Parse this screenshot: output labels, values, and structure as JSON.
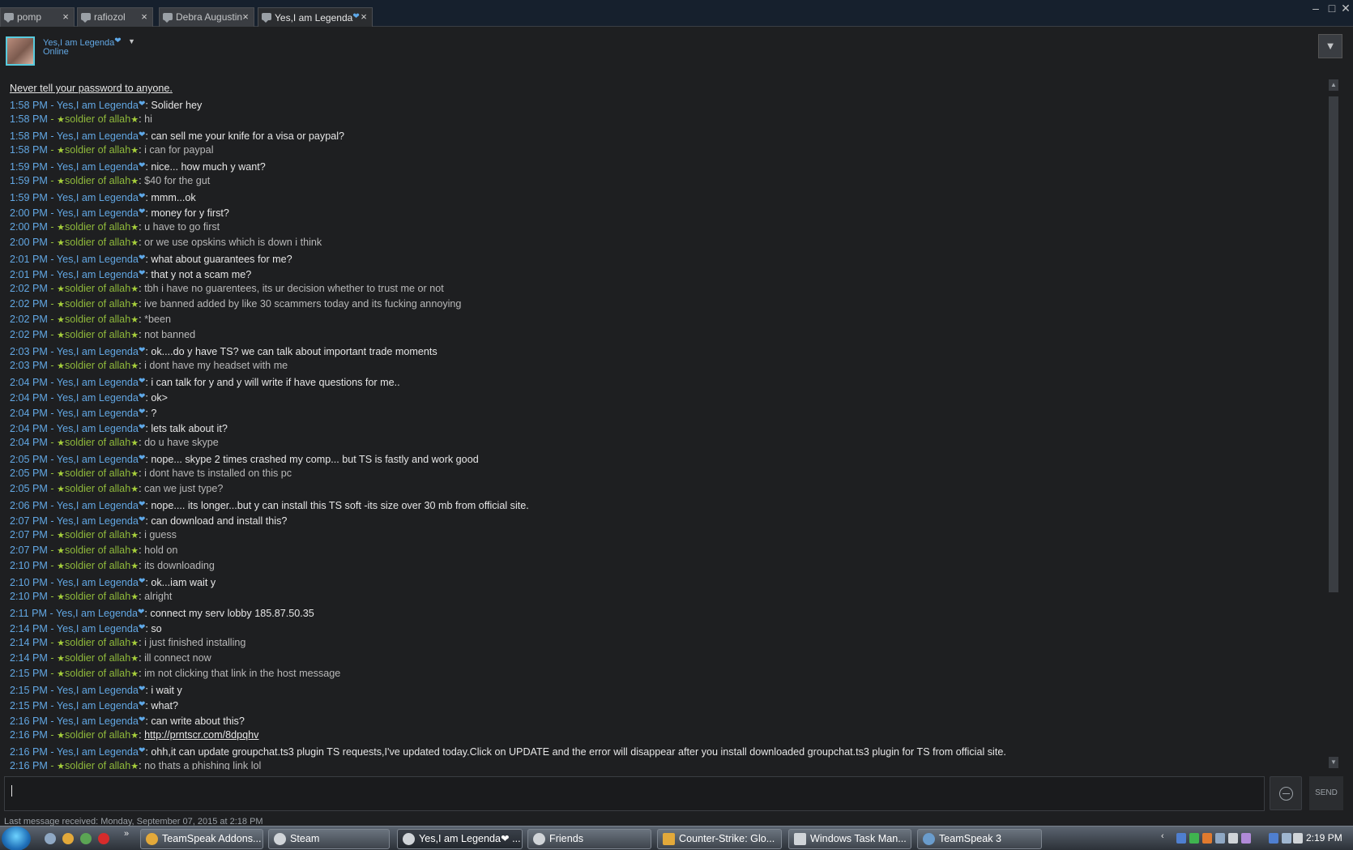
{
  "tabs": [
    {
      "label": "pomp",
      "close": "×",
      "active": false
    },
    {
      "label": "rafiozol",
      "close": "×",
      "active": false
    },
    {
      "label": "Debra Augustin",
      "close": "×",
      "active": false
    },
    {
      "label": "Yes,I am Legenda",
      "close": "×",
      "active": true
    }
  ],
  "window_controls": {
    "minimize": "–",
    "maximize": "□",
    "close": "✕"
  },
  "header": {
    "friend_name": "Yes,I am Legenda",
    "status": "Online",
    "dropdown": "▼"
  },
  "chat": {
    "warning": "Never tell your password to anyone.",
    "them_name": "Yes,I am Legenda",
    "me_name": "soldier of allah",
    "messages": [
      {
        "time": "1:58 PM",
        "from": "them",
        "text": "Solider hey"
      },
      {
        "time": "1:58 PM",
        "from": "me",
        "text": "hi"
      },
      {
        "time": "1:58 PM",
        "from": "them",
        "text": "can sell me your knife for a visa or paypal?"
      },
      {
        "time": "1:58 PM",
        "from": "me",
        "text": "i can for paypal"
      },
      {
        "time": "1:59 PM",
        "from": "them",
        "text": "nice... how much y want?"
      },
      {
        "time": "1:59 PM",
        "from": "me",
        "text": "$40 for the gut"
      },
      {
        "time": "1:59 PM",
        "from": "them",
        "text": "mmm...ok"
      },
      {
        "time": "2:00 PM",
        "from": "them",
        "text": "money for y first?"
      },
      {
        "time": "2:00 PM",
        "from": "me",
        "text": "u have to go first"
      },
      {
        "time": "2:00 PM",
        "from": "me",
        "text": "or we use opskins which is down i think"
      },
      {
        "time": "2:01 PM",
        "from": "them",
        "text": "what about guarantees for me?"
      },
      {
        "time": "2:01 PM",
        "from": "them",
        "text": "that y not a scam me?"
      },
      {
        "time": "2:02 PM",
        "from": "me",
        "text": "tbh i have no guarentees, its ur decision whether to trust me or not"
      },
      {
        "time": "2:02 PM",
        "from": "me",
        "text": "ive banned added by like 30 scammers today and its fucking annoying"
      },
      {
        "time": "2:02 PM",
        "from": "me",
        "text": "*been"
      },
      {
        "time": "2:02 PM",
        "from": "me",
        "text": "not banned"
      },
      {
        "time": "2:03 PM",
        "from": "them",
        "text": "ok....do y have TS? we can talk about important trade moments"
      },
      {
        "time": "2:03 PM",
        "from": "me",
        "text": "i dont have my headset with me"
      },
      {
        "time": "2:04 PM",
        "from": "them",
        "text": "i can talk for y and y will write if have questions for me.."
      },
      {
        "time": "2:04 PM",
        "from": "them",
        "text": "ok>"
      },
      {
        "time": "2:04 PM",
        "from": "them",
        "text": "?"
      },
      {
        "time": "2:04 PM",
        "from": "them",
        "text": "lets talk about it?"
      },
      {
        "time": "2:04 PM",
        "from": "me",
        "text": "do u have skype"
      },
      {
        "time": "2:05 PM",
        "from": "them",
        "text": "nope... skype 2 times crashed my comp... but TS is fastly and work good"
      },
      {
        "time": "2:05 PM",
        "from": "me",
        "text": "i dont have ts installed on this pc"
      },
      {
        "time": "2:05 PM",
        "from": "me",
        "text": "can we just type?"
      },
      {
        "time": "2:06 PM",
        "from": "them",
        "text": "nope.... its longer...but y can install this TS soft -its size over 30 mb from official site."
      },
      {
        "time": "2:07 PM",
        "from": "them",
        "text": "can download and install this?"
      },
      {
        "time": "2:07 PM",
        "from": "me",
        "text": "i guess"
      },
      {
        "time": "2:07 PM",
        "from": "me",
        "text": "hold on"
      },
      {
        "time": "2:10 PM",
        "from": "me",
        "text": "its downloading"
      },
      {
        "time": "2:10 PM",
        "from": "them",
        "text": "ok...iam wait y"
      },
      {
        "time": "2:10 PM",
        "from": "me",
        "text": "alright"
      },
      {
        "time": "2:11 PM",
        "from": "them",
        "text": "connect my serv lobby 185.87.50.35"
      },
      {
        "time": "2:14 PM",
        "from": "them",
        "text": "so"
      },
      {
        "time": "2:14 PM",
        "from": "me",
        "text": "i just finished installing"
      },
      {
        "time": "2:14 PM",
        "from": "me",
        "text": "ill connect now"
      },
      {
        "time": "2:15 PM",
        "from": "me",
        "text": "im not clicking that link in the host message"
      },
      {
        "time": "2:15 PM",
        "from": "them",
        "text": "i wait y"
      },
      {
        "time": "2:15 PM",
        "from": "them",
        "text": "what?"
      },
      {
        "time": "2:16 PM",
        "from": "them",
        "text": "can write about this?"
      },
      {
        "time": "2:16 PM",
        "from": "me",
        "text": "http://prntscr.com/8dpqhv",
        "link": true
      },
      {
        "time": "2:16 PM",
        "from": "them",
        "text": "ohh,it can update groupchat.ts3 plugin TS requests,I've updated today.Click on UPDATE and the error will disappear after you install downloaded groupchat.ts3 plugin for TS from official site."
      },
      {
        "time": "2:16 PM",
        "from": "me",
        "text": "no thats a phishing link lol"
      }
    ]
  },
  "input": {
    "send_label": "SEND"
  },
  "last_received": "Last message received: Monday, September 07, 2015 at 2:18 PM",
  "taskbar": {
    "tasks": [
      {
        "label": "TeamSpeak Addons...",
        "active": false
      },
      {
        "label": "Steam",
        "active": false
      },
      {
        "label": "Yes,I am Legenda❤ ...",
        "active": true
      },
      {
        "label": "Friends",
        "active": false
      },
      {
        "label": "Counter-Strike: Glo...",
        "active": false
      },
      {
        "label": "Windows Task Man...",
        "active": false
      },
      {
        "label": "TeamSpeak 3",
        "active": false
      }
    ],
    "ql_more": "»",
    "tray_arrow": "‹",
    "clock": "2:19 PM"
  },
  "colors": {
    "them": "#62a7e3",
    "me": "#8fb93b",
    "background": "#1e1f21"
  }
}
